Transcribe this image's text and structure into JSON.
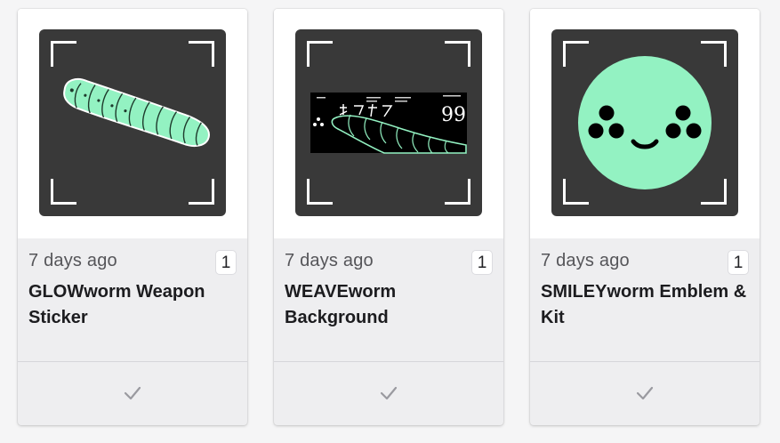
{
  "cards": [
    {
      "date": "7 days ago",
      "count": "1",
      "title": "GLOWworm Weapon Sticker",
      "thumbnail_icon": "caterpillar-sticker-icon"
    },
    {
      "date": "7 days ago",
      "count": "1",
      "title": "WEAVEworm Background",
      "thumbnail_icon": "caterpillar-banner-icon",
      "banner_number": "99"
    },
    {
      "date": "7 days ago",
      "count": "1",
      "title": "SMILEYworm Emblem & Kit",
      "thumbnail_icon": "smiley-face-icon"
    }
  ],
  "colors": {
    "thumb_bg": "#393939",
    "accent_green": "#93f2c2",
    "card_bg": "#eeeef0",
    "check_color": "#9a9aa0"
  },
  "footer_icon": "checkmark-icon"
}
